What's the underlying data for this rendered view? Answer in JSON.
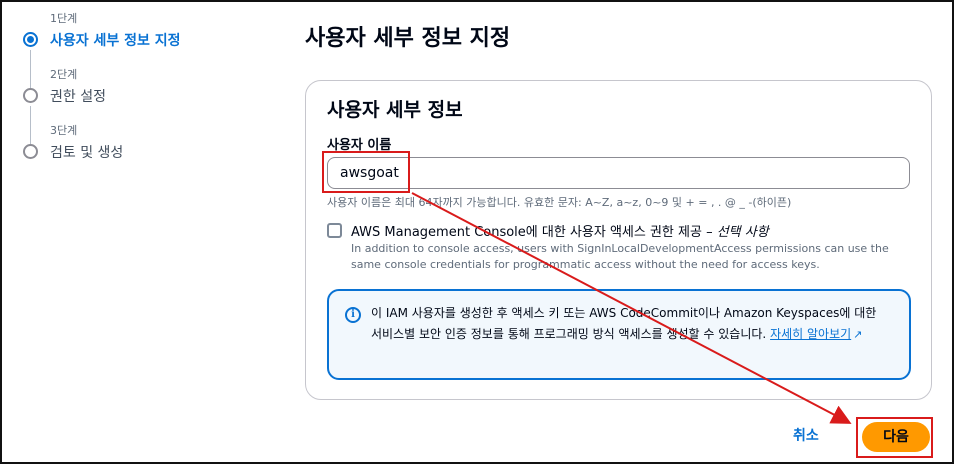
{
  "steps": [
    {
      "meta": "1단계",
      "label": "사용자 세부 정보 지정",
      "active": true
    },
    {
      "meta": "2단계",
      "label": "권한 설정",
      "active": false
    },
    {
      "meta": "3단계",
      "label": "검토 및 생성",
      "active": false
    }
  ],
  "page_title": "사용자 세부 정보 지정",
  "card": {
    "title": "사용자 세부 정보",
    "username_label": "사용자 이름",
    "username_value": "awsgoat",
    "username_constraint": "사용자 이름은 최대 64자까지 가능합니다. 유효한 문자: A~Z, a~z, 0~9 및 + = , . @ _ -(하이픈)",
    "console_access": {
      "checked": false,
      "label": "AWS Management Console에 대한 사용자 액세스 권한 제공 – ",
      "optional": "선택 사항",
      "description": "In addition to console access, users with SignInLocalDevelopmentAccess permissions can use the same console credentials for programmatic access without the need for access keys."
    },
    "info": {
      "text": "이 IAM 사용자를 생성한 후 액세스 키 또는 AWS CodeCommit이나 Amazon Keyspaces에 대한 서비스별 보안 인증 정보를 통해 프로그래밍 방식 액세스를 생성할 수 있습니다. ",
      "link": "자세히 알아보기",
      "icon": "info-icon",
      "link_icon": "external-link-icon"
    }
  },
  "actions": {
    "cancel": "취소",
    "next": "다음"
  },
  "colors": {
    "accent": "#0972d3",
    "primary_button": "#ff9900",
    "annotation": "#d91b1b"
  }
}
